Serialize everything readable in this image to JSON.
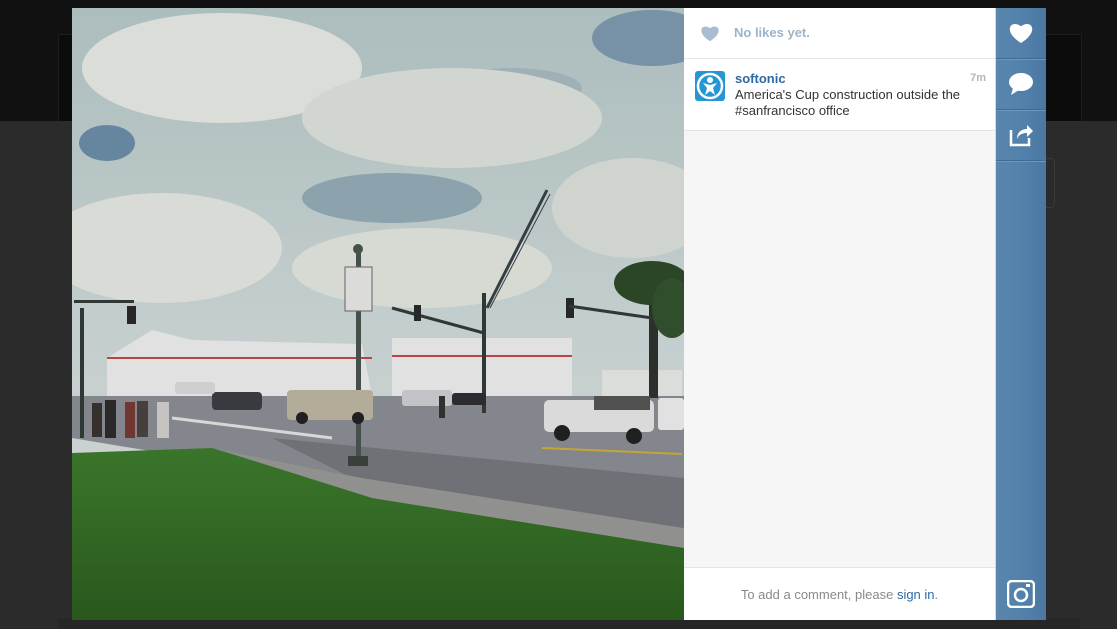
{
  "likes": {
    "text": "No likes yet."
  },
  "caption": {
    "username": "softonic",
    "time": "7m",
    "text_line1": "America's Cup construction outside the",
    "text_line2": "#sanfrancisco office"
  },
  "comments": {
    "prompt": "To add a comment, please ",
    "signin": "sign in",
    "suffix": "."
  },
  "icons": {
    "like": "heart-icon",
    "comment": "comment-bubble-icon",
    "share": "share-icon",
    "brand": "instagram-camera-icon"
  },
  "colors": {
    "accent_blue": "#5180aa",
    "link_blue": "#2e6aa1",
    "avatar_blue": "#2496d6"
  }
}
